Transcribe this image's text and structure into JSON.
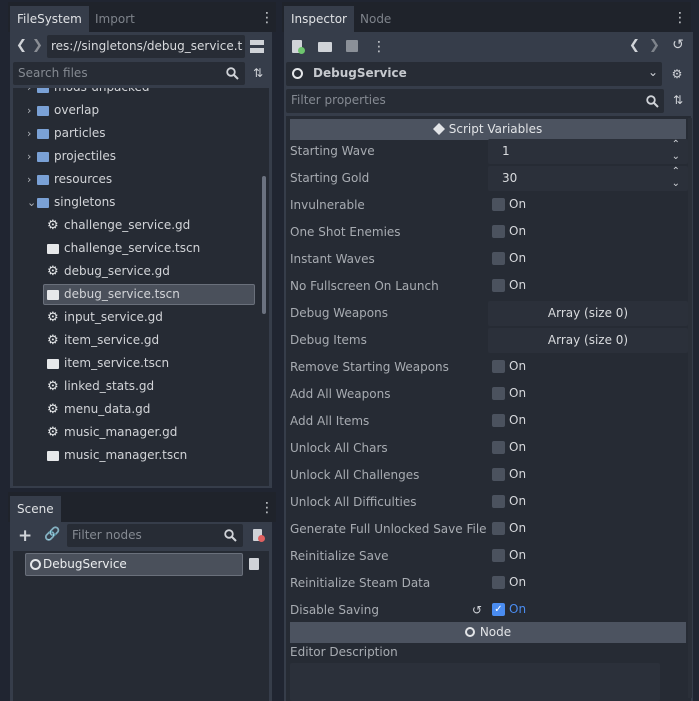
{
  "filesystem": {
    "tabs": [
      "FileSystem",
      "Import"
    ],
    "path": "res://singletons/debug_service.ts",
    "search_placeholder": "Search files",
    "items": [
      {
        "label": "mods-unpacked",
        "type": "folder",
        "expanded": false
      },
      {
        "label": "overlap",
        "type": "folder",
        "expanded": false
      },
      {
        "label": "particles",
        "type": "folder",
        "expanded": false
      },
      {
        "label": "projectiles",
        "type": "folder",
        "expanded": false
      },
      {
        "label": "resources",
        "type": "folder",
        "expanded": false
      },
      {
        "label": "singletons",
        "type": "folder",
        "expanded": true
      },
      {
        "label": "challenge_service.gd",
        "type": "script"
      },
      {
        "label": "challenge_service.tscn",
        "type": "scene"
      },
      {
        "label": "debug_service.gd",
        "type": "script"
      },
      {
        "label": "debug_service.tscn",
        "type": "scene",
        "selected": true
      },
      {
        "label": "input_service.gd",
        "type": "script"
      },
      {
        "label": "item_service.gd",
        "type": "script"
      },
      {
        "label": "item_service.tscn",
        "type": "scene"
      },
      {
        "label": "linked_stats.gd",
        "type": "script"
      },
      {
        "label": "menu_data.gd",
        "type": "script"
      },
      {
        "label": "music_manager.gd",
        "type": "script"
      },
      {
        "label": "music_manager.tscn",
        "type": "scene"
      }
    ]
  },
  "scene": {
    "tab": "Scene",
    "filter_placeholder": "Filter nodes",
    "root_node": "DebugService"
  },
  "inspector": {
    "tabs": [
      "Inspector",
      "Node"
    ],
    "object_name": "DebugService",
    "filter_placeholder": "Filter properties",
    "section_script": "Script Variables",
    "section_node": "Node",
    "editor_description_label": "Editor Description",
    "properties": [
      {
        "label": "Starting Wave",
        "kind": "spin",
        "value": "1"
      },
      {
        "label": "Starting Gold",
        "kind": "spin",
        "value": "30"
      },
      {
        "label": "Invulnerable",
        "kind": "bool",
        "value": "On",
        "checked": false
      },
      {
        "label": "One Shot Enemies",
        "kind": "bool",
        "value": "On",
        "checked": false
      },
      {
        "label": "Instant Waves",
        "kind": "bool",
        "value": "On",
        "checked": false
      },
      {
        "label": "No Fullscreen On Launch",
        "kind": "bool",
        "value": "On",
        "checked": false
      },
      {
        "label": "Debug Weapons",
        "kind": "array",
        "value": "Array (size 0)"
      },
      {
        "label": "Debug Items",
        "kind": "array",
        "value": "Array (size 0)"
      },
      {
        "label": "Remove Starting Weapons",
        "kind": "bool",
        "value": "On",
        "checked": false
      },
      {
        "label": "Add All Weapons",
        "kind": "bool",
        "value": "On",
        "checked": false
      },
      {
        "label": "Add All Items",
        "kind": "bool",
        "value": "On",
        "checked": false
      },
      {
        "label": "Unlock All Chars",
        "kind": "bool",
        "value": "On",
        "checked": false
      },
      {
        "label": "Unlock All Challenges",
        "kind": "bool",
        "value": "On",
        "checked": false
      },
      {
        "label": "Unlock All Difficulties",
        "kind": "bool",
        "value": "On",
        "checked": false
      },
      {
        "label": "Generate Full Unlocked Save File",
        "kind": "bool",
        "value": "On",
        "checked": false
      },
      {
        "label": "Reinitialize Save",
        "kind": "bool",
        "value": "On",
        "checked": false
      },
      {
        "label": "Reinitialize Steam Data",
        "kind": "bool",
        "value": "On",
        "checked": false
      },
      {
        "label": "Disable Saving",
        "kind": "bool",
        "value": "On",
        "checked": true,
        "revertable": true
      }
    ]
  },
  "colors": {
    "accent": "#4a8cf0",
    "folder": "#7aa1d6",
    "panel": "#363d4a",
    "background": "#202531"
  }
}
